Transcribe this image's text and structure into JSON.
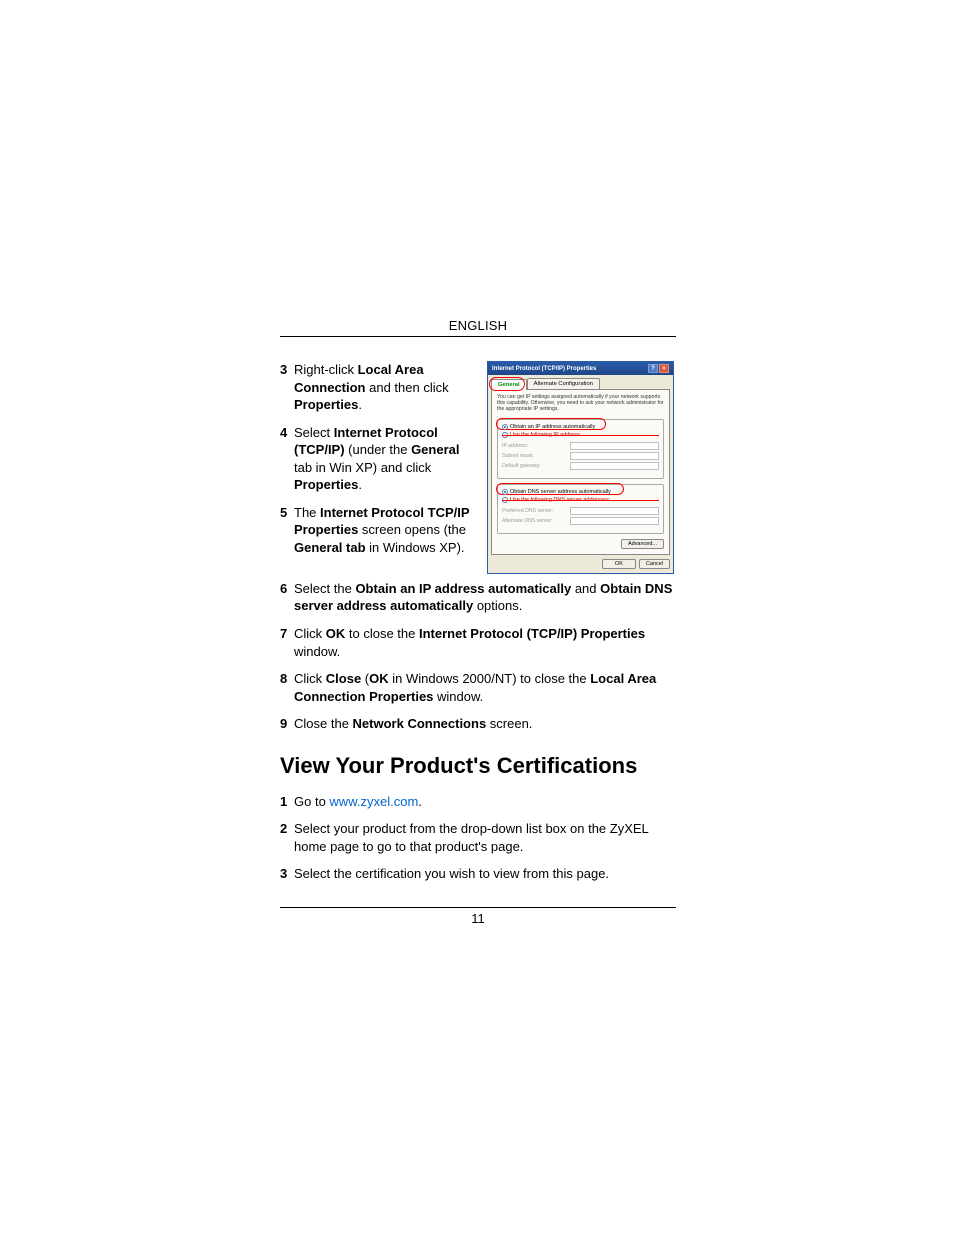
{
  "header": {
    "language": "ENGLISH"
  },
  "dialog": {
    "title": "Internet Protocol (TCP/IP) Properties",
    "tabs": {
      "general": "General",
      "alt": "Alternate Configuration"
    },
    "intro": "You can get IP settings assigned automatically if your network supports this capability. Otherwise, you need to ask your network administrator for the appropriate IP settings.",
    "radio_ip_auto": "Obtain an IP address automatically",
    "radio_ip_manual": "Use the following IP address:",
    "lbl_ip": "IP address:",
    "lbl_mask": "Subnet mask:",
    "lbl_gw": "Default gateway:",
    "radio_dns_auto": "Obtain DNS server address automatically",
    "radio_dns_manual": "Use the following DNS server addresses:",
    "lbl_pref_dns": "Preferred DNS server:",
    "lbl_alt_dns": "Alternate DNS server:",
    "btn_adv": "Advanced...",
    "btn_ok": "OK",
    "btn_cancel": "Cancel"
  },
  "steps_top": {
    "s3": {
      "num": "3",
      "pre": "Right-click ",
      "b1": "Local Area Connection",
      "mid": " and then click ",
      "b2": "Properties",
      "post": "."
    },
    "s4": {
      "num": "4",
      "pre": "Select ",
      "b1": "Internet Protocol (TCP/IP)",
      "mid1": " (under the ",
      "b2": "General",
      "mid2": " tab in Win XP) and click ",
      "b3": "Properties",
      "post": "."
    },
    "s5": {
      "num": "5",
      "pre": "The ",
      "b1": "Internet Protocol TCP/IP Properties",
      "mid1": " screen opens (the ",
      "b2": "General tab",
      "post": " in Windows XP)."
    }
  },
  "steps_full": {
    "s6": {
      "num": "6",
      "pre": "Select the ",
      "b1": "Obtain an IP address automatically",
      "mid": " and ",
      "b2": "Obtain DNS server address automatically",
      "post": " options."
    },
    "s7": {
      "num": "7",
      "pre": "Click ",
      "b1": "OK",
      "mid": " to close the ",
      "b2": "Internet Protocol (TCP/IP) Properties",
      "post": " window."
    },
    "s8": {
      "num": "8",
      "pre": "Click ",
      "b1": "Close",
      "mid1": " (",
      "b2": "OK",
      "mid2": " in Windows 2000/NT) to close the ",
      "b3": "Local Area Connection Properties",
      "post": " window."
    },
    "s9": {
      "num": "9",
      "pre": "Close the ",
      "b1": "Network Connections",
      "post": " screen."
    }
  },
  "section_title": "View Your Product's Certifications",
  "cert_steps": {
    "c1": {
      "num": "1",
      "pre": "Go to ",
      "link": "www.zyxel.com",
      "post": "."
    },
    "c2": {
      "num": "2",
      "txt": "Select your product from the drop-down list box on the ZyXEL home page to go to that product's page."
    },
    "c3": {
      "num": "3",
      "txt": "Select the certification you wish to view from this page."
    }
  },
  "footer": {
    "page_num": "11"
  }
}
